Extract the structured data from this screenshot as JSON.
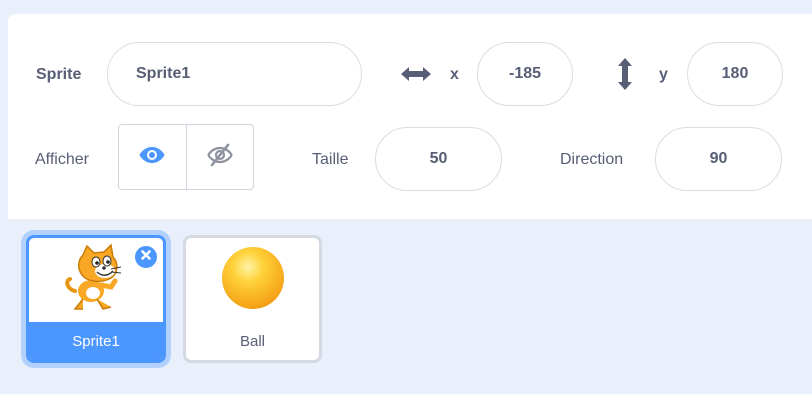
{
  "sprite_info": {
    "sprite_label": "Sprite",
    "sprite_name": "Sprite1",
    "x_label": "x",
    "x_value": "-185",
    "y_label": "y",
    "y_value": "180",
    "show_label": "Afficher",
    "show_visible": true,
    "size_label": "Taille",
    "size_value": "50",
    "direction_label": "Direction",
    "direction_value": "90"
  },
  "sprites": [
    {
      "name": "Sprite1",
      "icon": "scratch-cat-icon",
      "selected": true
    },
    {
      "name": "Ball",
      "icon": "ball-icon",
      "selected": false
    }
  ],
  "colors": {
    "accent": "#4c97ff",
    "text": "#575e75",
    "tray_bg": "#e9f0fb",
    "ball": "#ffb31a"
  }
}
